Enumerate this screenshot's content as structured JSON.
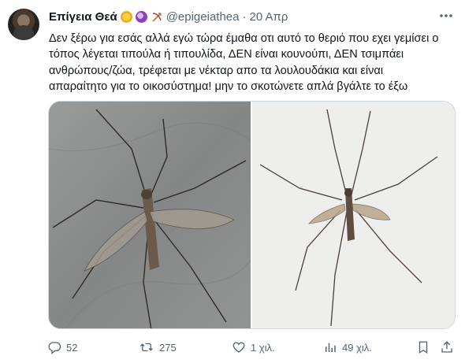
{
  "tweet": {
    "author_name": "Επίγεια Θεά",
    "handle": "@epigeiathea",
    "separator": "·",
    "date": "20 Απρ",
    "text_lines": [
      "Δεν ξέρω για εσάς αλλά εγώ τώρα έμαθα οτι αυτό το θεριό που εχει γεμίσει ο",
      "τόπος λέγεται τιπούλα ή τιπουλίδα, ΔΕΝ είναι κουνούπι, ΔΕΝ τσιμπάει",
      "ανθρώπους/ζώα, τρέφεται με νέκταρ απο τα λουλουδάκια και είναι",
      "απαραίτητο για το οικοσύστημα! μην το σκοτώνετε απλά βγάλτε το έξω"
    ],
    "emojis": [
      "sparkles-emoji",
      "crystal-ball-emoji",
      "bow-and-arrow-emoji"
    ]
  },
  "media": {
    "images": [
      "crane-fly-photo-on-stone",
      "crane-fly-photo-on-white-wall"
    ]
  },
  "actions": {
    "replies": "52",
    "retweets": "275",
    "likes": "1 χιλ.",
    "views": "49 χιλ."
  },
  "icons": {
    "reply": "reply-icon",
    "retweet": "retweet-icon",
    "like": "heart-icon",
    "views": "views-chart-icon",
    "bookmark": "bookmark-icon",
    "share": "share-icon",
    "more": "more-dots-icon"
  },
  "colors": {
    "text": "#0f1419",
    "secondary": "#536471",
    "border": "#cfd9de"
  }
}
